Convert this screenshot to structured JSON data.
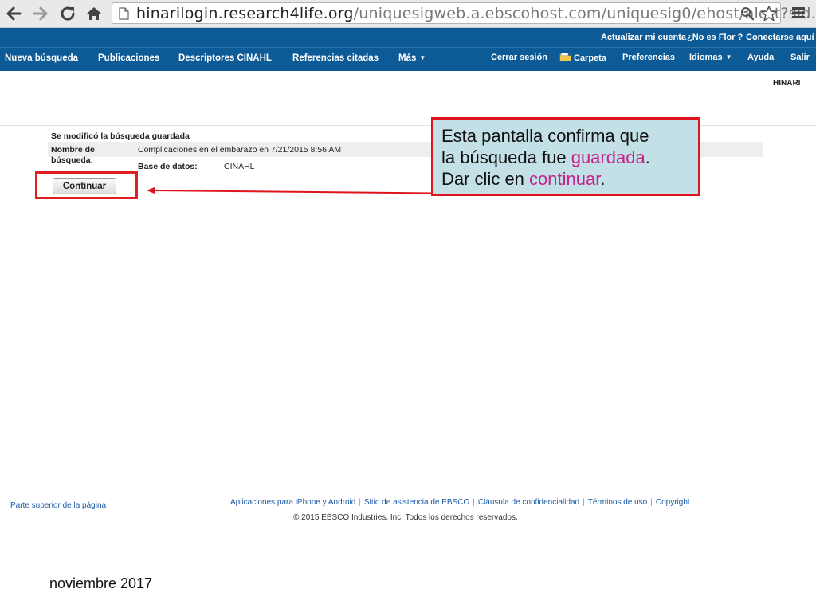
{
  "browser": {
    "url_host": "hinarilogin.research4life.org",
    "url_path": "/uniquesigweb.a.ebscohost.com/uniquesig0/ehost/alert?sid..."
  },
  "topbar": {
    "account": "Actualizar mi cuenta",
    "not_user": "¿No es Flor ?",
    "login_here": "Conectarse aquí"
  },
  "nav": {
    "new_search": "Nueva búsqueda",
    "publications": "Publicaciones",
    "descriptors": "Descriptores CINAHL",
    "cited_refs": "Referencias citadas",
    "more": "Más",
    "logout": "Cerrar sesión",
    "folder": "Carpeta",
    "preferences": "Preferencias",
    "languages": "Idiomas",
    "help": "Ayuda",
    "exit": "Salir"
  },
  "institution": "HINARI",
  "content": {
    "title": "Se modificó la búsqueda guardada",
    "name_label_1": "Nombre de",
    "name_label_2": "búsqueda:",
    "name_value": "Complicaciones en el embarazo en 7/21/2015 8:56 AM",
    "db_label": "Base de datos:",
    "db_value": "CINAHL",
    "continue_button": "Continuar"
  },
  "callout": {
    "line1": "Esta pantalla confirma que",
    "line2_pre": "la búsqueda fue ",
    "line2_pink": "guardada",
    "line2_post": ".",
    "line3_pre": "Dar clic en ",
    "line3_pink": "continuar",
    "line3_post": "."
  },
  "footer": {
    "top_of_page": "Parte superior de la página",
    "links": [
      "Aplicaciones para iPhone y Android",
      "Sitio de asistencia de EBSCO",
      "Cláusula de confidencialidad",
      "Términos de uso",
      "Copyright"
    ],
    "copyright": "© 2015 EBSCO Industries, Inc. Todos los derechos reservados."
  },
  "slide_date": "noviembre 2017",
  "colors": {
    "nav_bar": "#0c5a96",
    "callout_bg": "#c2e0e5",
    "highlight_red": "#e0141e",
    "callout_pink": "#c8208c",
    "link_blue": "#1a5aa6"
  },
  "icons": [
    "back-icon",
    "forward-icon",
    "reload-icon",
    "home-icon",
    "page-icon",
    "search-zoom-icon",
    "star-icon",
    "menu-icon",
    "folder-icon"
  ]
}
